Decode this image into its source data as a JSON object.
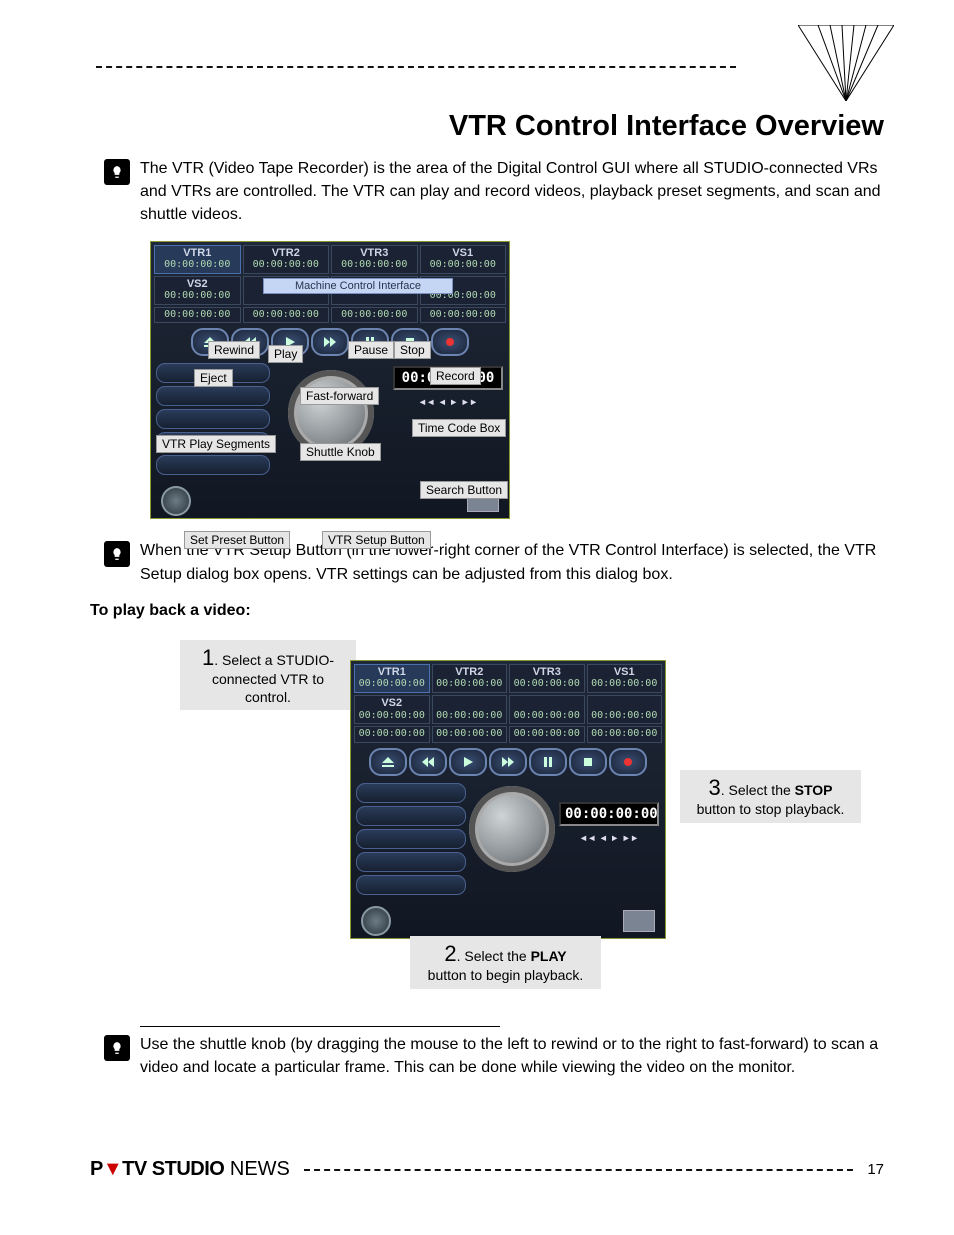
{
  "title": "VTR Control Interface Overview",
  "tip1": "The VTR (Video Tape Recorder) is the area of the Digital Control GUI where all STUDIO-connected VRs and VTRs are controlled.  The VTR can play and record videos, playback preset segments, and scan and shuttle videos.",
  "tip2": "When the VTR Setup Button (in the lower-right corner of the VTR Control Interface) is selected, the VTR Setup dialog box opens.  VTR settings can be adjusted from this dialog box.",
  "tip3": "Use the shuttle knob (by dragging the mouse to the left to rewind or to the right to fast-forward) to scan a video and locate a particular frame.  This can be done while viewing the video on the monitor.",
  "playback_heading": "To play back a video:",
  "panel": {
    "slots": [
      {
        "name": "VTR1",
        "tc": "00:00:00:00"
      },
      {
        "name": "VTR2",
        "tc": "00:00:00:00"
      },
      {
        "name": "VTR3",
        "tc": "00:00:00:00"
      },
      {
        "name": "VS1",
        "tc": "00:00:00:00"
      },
      {
        "name": "VS2",
        "tc": "00:00:00:00"
      }
    ],
    "mci_label": "Machine Control Interface",
    "blank_tc": "00:00:00:00",
    "row3_tcs": [
      "00:00:00:00",
      "00:00:00:00",
      "00:00:00:00",
      "00:00:00:00"
    ],
    "big_tc": "00:00:00:00"
  },
  "callouts": {
    "rewind": "Rewind",
    "play": "Play",
    "pause": "Pause",
    "stop": "Stop",
    "eject": "Eject",
    "record": "Record",
    "ff": "Fast-forward",
    "segments": "VTR Play Segments",
    "knob": "Shuttle Knob",
    "tcbox": "Time Code Box",
    "search": "Search Button",
    "setpreset": "Set Preset Button",
    "setup": "VTR Setup Button"
  },
  "steps": {
    "s1_num": "1",
    "s1_t1": ". Select a STUDIO-",
    "s1_t2": "connected VTR to",
    "s1_t3": "control.",
    "s2_num": "2",
    "s2_t1": ". Select the ",
    "s2_bold": "PLAY",
    "s2_t2": "button to begin playback.",
    "s3_num": "3",
    "s3_t1": ". Select the ",
    "s3_bold": "STOP",
    "s3_t2": "button to stop playback."
  },
  "footer": {
    "brand_p": "P",
    "brand_tv": "TV",
    "brand_studio": "STUDIO",
    "brand_news": " NEWS",
    "page": "17"
  }
}
